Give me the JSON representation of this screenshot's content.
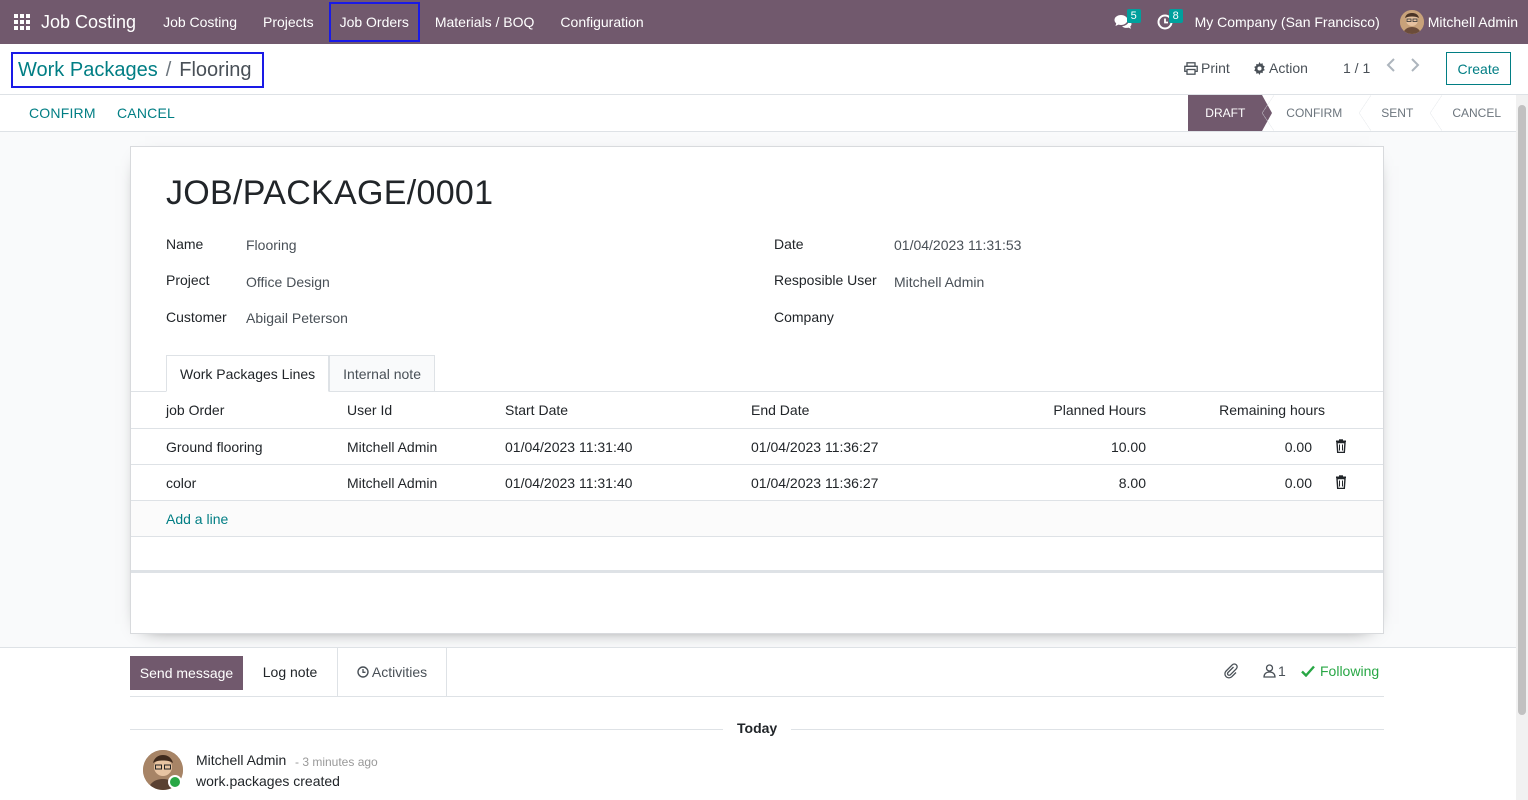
{
  "navbar": {
    "brand": "Job Costing",
    "menu": [
      "Job Costing",
      "Projects",
      "Job Orders",
      "Materials / BOQ",
      "Configuration"
    ],
    "messages_count": "5",
    "activities_count": "8",
    "company": "My Company (San Francisco)",
    "user": "Mitchell Admin"
  },
  "breadcrumb": {
    "parent": "Work Packages",
    "separator": "/",
    "current": "Flooring"
  },
  "control": {
    "print": "Print",
    "action": "Action",
    "pager": "1 / 1",
    "create": "Create"
  },
  "statusbar": {
    "buttons": [
      "CONFIRM",
      "CANCEL"
    ],
    "stages": [
      "DRAFT",
      "CONFIRM",
      "SENT",
      "CANCEL"
    ],
    "active_stage": "DRAFT"
  },
  "form": {
    "title": "JOB/PACKAGE/0001",
    "left_fields": [
      {
        "label": "Name",
        "value": "Flooring"
      },
      {
        "label": "Project",
        "value": "Office Design"
      },
      {
        "label": "Customer",
        "value": "Abigail Peterson"
      }
    ],
    "right_fields": [
      {
        "label": "Date",
        "value": "01/04/2023 11:31:53"
      },
      {
        "label": "Resposible User",
        "value": "Mitchell Admin"
      },
      {
        "label": "Company",
        "value": ""
      }
    ],
    "tabs": [
      "Work Packages Lines",
      "Internal note"
    ],
    "table": {
      "headers": [
        "job Order",
        "User Id",
        "Start Date",
        "End Date",
        "Planned Hours",
        "Remaining hours"
      ],
      "rows": [
        [
          "Ground flooring",
          "Mitchell Admin",
          "01/04/2023 11:31:40",
          "01/04/2023 11:36:27",
          "10.00",
          "0.00"
        ],
        [
          "color",
          "Mitchell Admin",
          "01/04/2023 11:31:40",
          "01/04/2023 11:36:27",
          "8.00",
          "0.00"
        ]
      ],
      "add_line": "Add a line"
    }
  },
  "chatter": {
    "send_message": "Send message",
    "log_note": "Log note",
    "activities": "Activities",
    "followers_count": "1",
    "following": "Following",
    "date_separator": "Today",
    "message": {
      "author": "Mitchell Admin",
      "date": "- 3 minutes ago",
      "body": "work.packages created"
    }
  },
  "colors": {
    "primary": "#71596d",
    "link": "#017e84",
    "badge": "#00a09d",
    "following": "#28a745"
  }
}
